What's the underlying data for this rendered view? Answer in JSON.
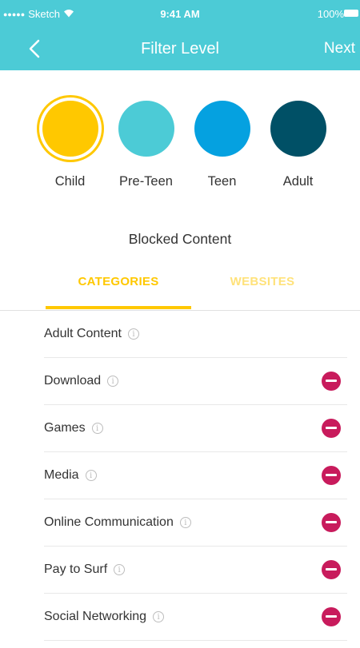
{
  "status_bar": {
    "carrier": "Sketch",
    "signal_dots": "●●●●●",
    "time": "9:41 AM",
    "battery": "100%"
  },
  "nav": {
    "title": "Filter Level",
    "next_label": "Next",
    "back_icon": "chevron-left-icon"
  },
  "filter_levels": [
    {
      "label": "Child",
      "color": "#ffc800",
      "selected": true
    },
    {
      "label": "Pre-Teen",
      "color": "#4ccbd6",
      "selected": false
    },
    {
      "label": "Teen",
      "color": "#05a1e0",
      "selected": false
    },
    {
      "label": "Adult",
      "color": "#005066",
      "selected": false
    }
  ],
  "blocked_content": {
    "title": "Blocked Content",
    "tabs": [
      {
        "label": "CATEGORIES",
        "active": true
      },
      {
        "label": "WEBSITES",
        "active": false
      }
    ]
  },
  "categories": [
    {
      "label": "Adult Content",
      "removable": false
    },
    {
      "label": "Download",
      "removable": true
    },
    {
      "label": "Games",
      "removable": true
    },
    {
      "label": "Media",
      "removable": true
    },
    {
      "label": "Online Communication",
      "removable": true
    },
    {
      "label": "Pay to Surf",
      "removable": true
    },
    {
      "label": "Social Networking",
      "removable": true
    }
  ],
  "colors": {
    "accent": "#4ccbd6",
    "tab_active": "#ffc800",
    "remove": "#c81b5c"
  }
}
